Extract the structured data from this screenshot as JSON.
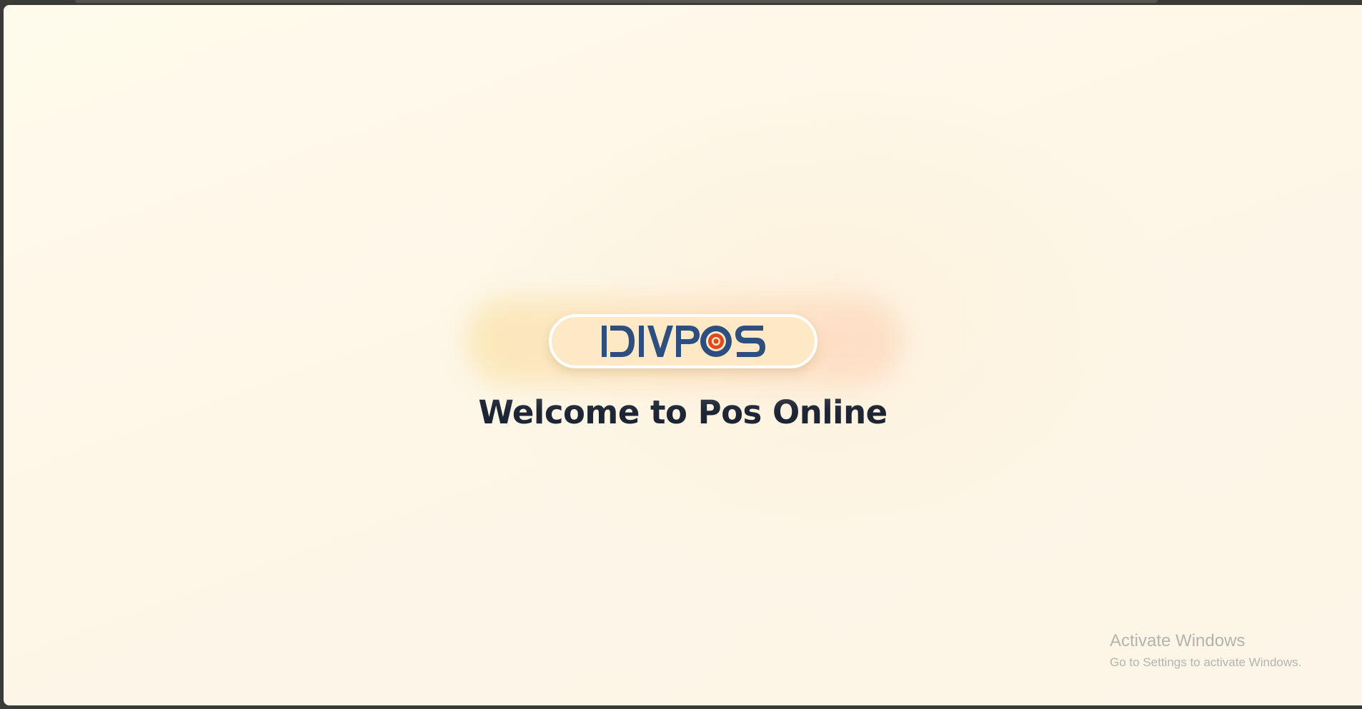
{
  "logo": {
    "text": "IDIVPOS",
    "icon": "target-icon",
    "colors": {
      "brand": "#2f4e80",
      "accent": "#e4471d",
      "pill": "#fde9c6"
    }
  },
  "welcome": {
    "title": "Welcome to Pos Online"
  },
  "watermark": {
    "title": "Activate Windows",
    "subtitle": "Go to Settings to activate Windows."
  }
}
